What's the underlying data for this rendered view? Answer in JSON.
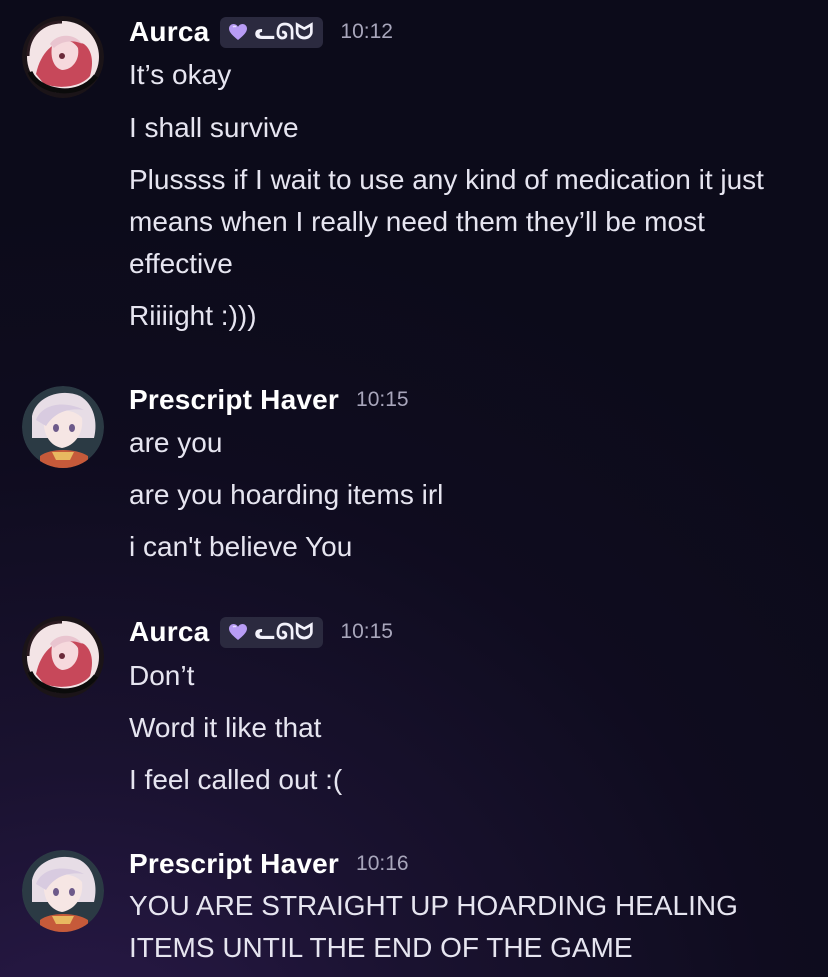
{
  "messages": [
    {
      "author": "Aurca",
      "tag": "ᓚᘏᗢ",
      "time": "10:12",
      "lines": [
        "It’s okay",
        "I shall survive",
        "Plussss if I wait to use any kind of medication it just means when I really need them they’ll be most effective",
        "Riiiight :)))"
      ]
    },
    {
      "author": "Prescript Haver",
      "time": "10:15",
      "lines": [
        "are you",
        "are you hoarding items irl",
        "i can't believe You"
      ]
    },
    {
      "author": "Aurca",
      "tag": "ᓚᘏᗢ",
      "time": "10:15",
      "lines": [
        "Don’t",
        "Word it like that",
        "I feel called out :("
      ]
    },
    {
      "author": "Prescript Haver",
      "time": "10:16",
      "lines": [
        "YOU ARE STRAIGHT UP HOARDING HEALING ITEMS UNTIL THE END OF THE GAME"
      ]
    }
  ],
  "icons": {
    "tag_icon": "purple-heart-icon",
    "avatar_aurca": "avatar-aurca",
    "avatar_prescript": "avatar-prescript-haver"
  },
  "colors": {
    "background": "#0f0c1f",
    "username": "#ffffff",
    "message_text": "#e6e5f0",
    "timestamp": "#a8a6bb",
    "tag_background": "#2b2a3f",
    "heart": "#b89cf5"
  }
}
